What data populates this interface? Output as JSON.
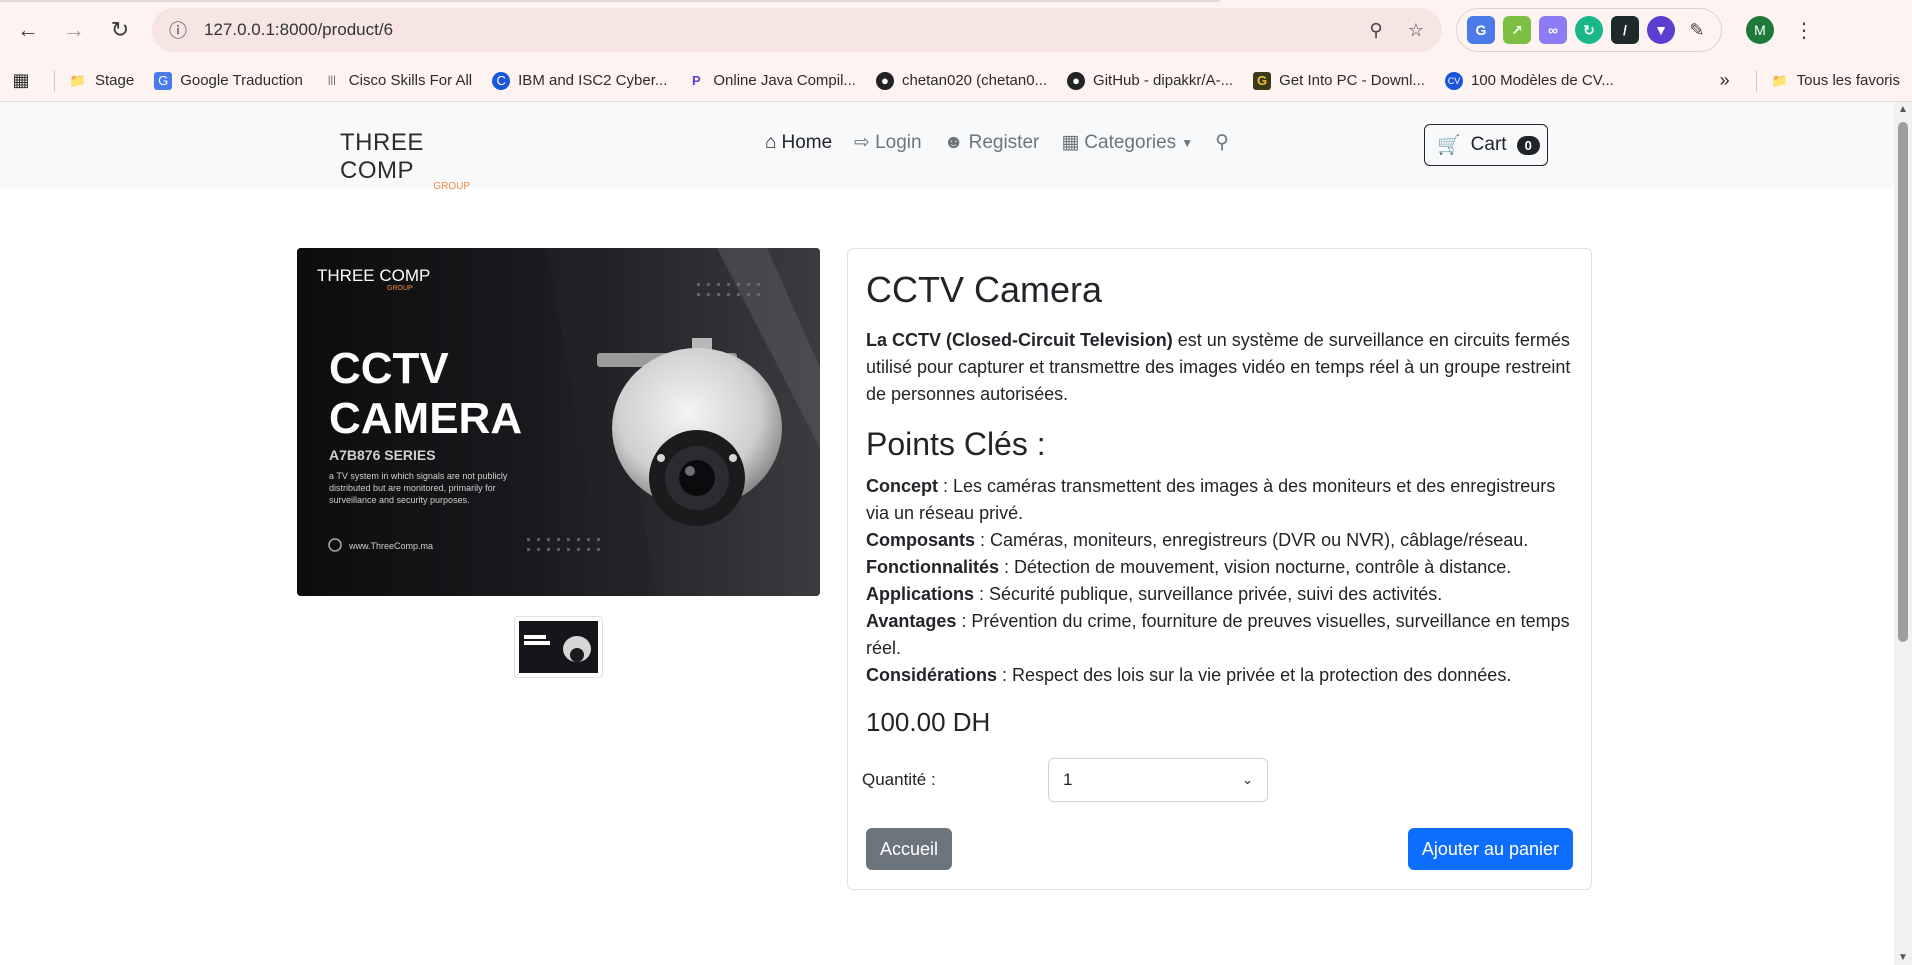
{
  "browser": {
    "url": "127.0.0.1:8000/product/6",
    "profile_initial": "M"
  },
  "bookmarks": {
    "items": [
      "Stage",
      "Google Traduction",
      "Cisco Skills For All",
      "IBM and ISC2 Cyber...",
      "Online Java Compil...",
      "chetan020 (chetan0...",
      "GitHub - dipakkr/A-...",
      "Get Into PC - Downl...",
      "100 Modèles de CV..."
    ],
    "favorites": "Tous les favoris"
  },
  "site": {
    "logo_main": "THREE COMP",
    "logo_sub": "GROUP",
    "nav": {
      "home": "Home",
      "login": "Login",
      "register": "Register",
      "categories": "Categories"
    },
    "cart_label": "Cart",
    "cart_count": "0"
  },
  "product": {
    "title": "CCTV Camera",
    "desc_bold": "La CCTV (Closed-Circuit Television)",
    "desc_rest": " est un système de surveillance en circuits fermés utilisé pour capturer et transmettre des images vidéo en temps réel à un groupe restreint de personnes autorisées.",
    "points_title": "Points Clés :",
    "points": [
      {
        "k": "Concept",
        "v": " : Les caméras transmettent des images à des moniteurs et des enregistreurs via un réseau privé."
      },
      {
        "k": "Composants",
        "v": " : Caméras, moniteurs, enregistreurs (DVR ou NVR), câblage/réseau."
      },
      {
        "k": "Fonctionnalités",
        "v": " : Détection de mouvement, vision nocturne, contrôle à distance."
      },
      {
        "k": "Applications",
        "v": " : Sécurité publique, surveillance privée, suivi des activités."
      },
      {
        "k": "Avantages",
        "v": " : Prévention du crime, fourniture de preuves visuelles, surveillance en temps réel."
      },
      {
        "k": "Considérations",
        "v": " : Respect des lois sur la vie privée et la protection des données."
      }
    ],
    "price": "100.00 DH",
    "qty_label": "Quantité :",
    "qty_value": "1",
    "btn_home": "Accueil",
    "btn_add": "Ajouter au panier"
  },
  "hero_image": {
    "brand": "THREE COMP",
    "brand_sub": "GROUP",
    "line1": "CCTV",
    "line2": "CAMERA",
    "series": "A7B876 SERIES",
    "blurb": "a TV system in which signals are not publicly distributed but are monitored, primarily for surveillance and security purposes.",
    "site": "www.ThreeComp.ma"
  }
}
